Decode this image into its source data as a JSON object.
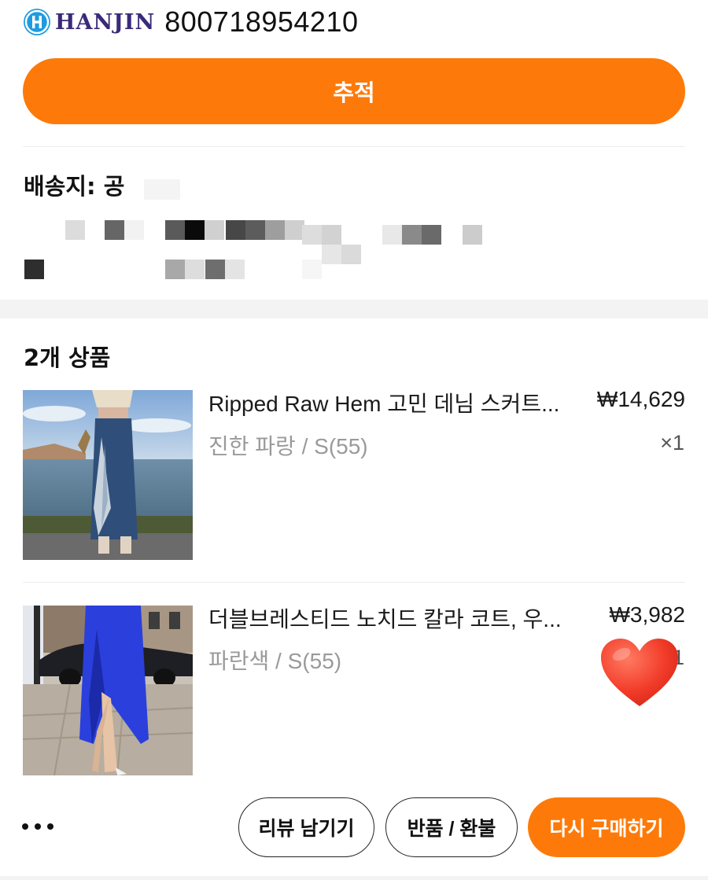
{
  "shipment": {
    "carrier_name": "HANJIN",
    "tracking_number": "800718954210",
    "track_button_label": "추적"
  },
  "address": {
    "title": "배송지: 공"
  },
  "order": {
    "items_count_label": "2개 상품",
    "items": [
      {
        "name": "Ripped Raw Hem 고민 데님 스커트...",
        "variant": "진한 파랑 / S(55)",
        "price": "₩14,629",
        "quantity": "×1",
        "image": "denim-skirt-photo"
      },
      {
        "name": "더블브레스티드 노치드 칼라 코트, 우...",
        "variant": "파란색 / S(55)",
        "price": "₩3,982",
        "quantity": "×1",
        "image": "blue-coat-photo"
      }
    ]
  },
  "actions": {
    "more_icon": "more-horizontal-icon",
    "review_label": "리뷰 남기기",
    "return_label": "반품 / 환불",
    "rebuy_label": "다시 구매하기"
  },
  "colors": {
    "accent": "#fd7a0a",
    "carrier_logo_blue": "#1e9be0",
    "carrier_text": "#3a2a7a",
    "secondary_text": "#9a9a9a",
    "heart": "#f23c2a"
  }
}
